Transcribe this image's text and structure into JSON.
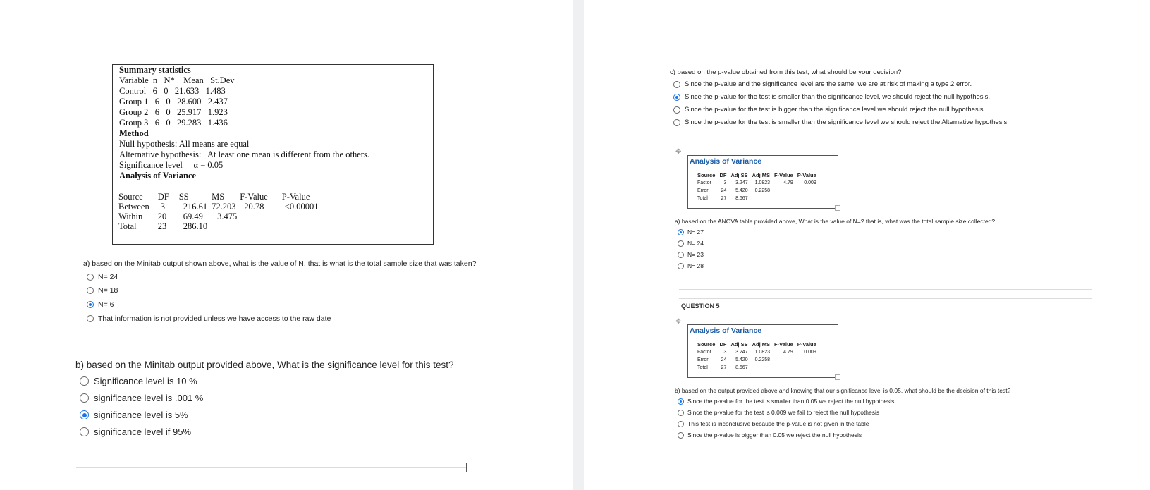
{
  "summary": {
    "lines": [
      {
        "text": "Summary statistics",
        "bold": true
      },
      {
        "text": "Variable  n   N*    Mean   St.Dev",
        "bold": false
      },
      {
        "text": "Control   6   0   21.633   1.483",
        "bold": false
      },
      {
        "text": "Group 1   6   0   28.600   2.437",
        "bold": false
      },
      {
        "text": "Group 2   6   0   25.917   1.923",
        "bold": false
      },
      {
        "text": "Group 3   6   0   29.283   1.436",
        "bold": false
      },
      {
        "text": "Method",
        "bold": true
      },
      {
        "text": "Null hypothesis: All means are equal",
        "bold": false
      },
      {
        "text": "Alternative hypothesis:   At least one mean is different from the others.",
        "bold": false
      },
      {
        "text": "Significance level     α = 0.05",
        "bold": false
      },
      {
        "text": "Analysis of Variance",
        "bold": true
      }
    ],
    "anova_header": [
      "Source",
      "DF",
      "SS",
      "MS",
      "F-Value",
      "P-Value"
    ],
    "anova_rows": [
      [
        "Between",
        "3",
        "216.61",
        "72.203",
        "20.78",
        "<0.00001"
      ],
      [
        "Within",
        "20",
        "69.49",
        "3.475",
        "",
        ""
      ],
      [
        "Total",
        "23",
        "286.10",
        "",
        "",
        ""
      ]
    ]
  },
  "left_questions": {
    "a": {
      "prompt": "a) based on the Minitab output shown above, what is the value of N, that is what is the total sample size that was taken?",
      "options": [
        {
          "label": "N= 24",
          "selected": false
        },
        {
          "label": "N= 18",
          "selected": false
        },
        {
          "label": "N= 6",
          "selected": true
        },
        {
          "label": "That information is not provided unless we have access to the raw date",
          "selected": false
        }
      ]
    },
    "b": {
      "prompt": "b) based on the Minitab output provided above, What is the significance level for this test?",
      "options": [
        {
          "label": "Significance level is 10 %",
          "selected": false
        },
        {
          "label": "significance level is .001 %",
          "selected": false
        },
        {
          "label": "significance level is 5%",
          "selected": true
        },
        {
          "label": "significance level if 95%",
          "selected": false
        }
      ]
    }
  },
  "right_questions": {
    "c": {
      "prompt": "c) based on the p-value obtained from this test, what should be your decision?",
      "options": [
        {
          "label": "Since the p-value and the significance level are the same, we are at risk of making a type 2 error.",
          "selected": false
        },
        {
          "label": "Since the p-value for the test is smaller than the significance level, we should reject the null hypothesis.",
          "selected": true
        },
        {
          "label": "Since the p-value for the test is bigger than the significance level we should reject the null hypothesis",
          "selected": false
        },
        {
          "label": "Since the p-value for the test is smaller than the significance level we should reject the Alternative hypothesis",
          "selected": false
        }
      ]
    },
    "anova_table": {
      "title": "Analysis of Variance",
      "header": [
        "Source",
        "DF",
        "Adj SS",
        "Adj MS",
        "F-Value",
        "P-Value"
      ],
      "rows": [
        [
          "Factor",
          "3",
          "3.247",
          "1.0823",
          "4.79",
          "0.009"
        ],
        [
          "Error",
          "24",
          "5.420",
          "0.2258",
          "",
          ""
        ],
        [
          "Total",
          "27",
          "8.667",
          "",
          "",
          ""
        ]
      ]
    },
    "a2": {
      "prompt": "a) based on the ANOVA table provided above, What is the value of N=? that is, what was the total sample size collected?",
      "options": [
        {
          "label": "N= 27",
          "selected": true
        },
        {
          "label": "N= 24",
          "selected": false
        },
        {
          "label": "N= 23",
          "selected": false
        },
        {
          "label": "N= 28",
          "selected": false
        }
      ]
    },
    "question5_label": "QUESTION 5",
    "b5": {
      "prompt": "b) based on the output provided above and knowing that our significance level is 0.05, what should be the decision of this test?",
      "options": [
        {
          "label": "Since the p-value for the test is smaller than 0.05 we reject the null hypothesis",
          "selected": true
        },
        {
          "label": "Since the p-value for the test is 0.009 we fail to reject the null hypothesis",
          "selected": false
        },
        {
          "label": "This test is inconclusive because the p-value is not given in the table",
          "selected": false
        },
        {
          "label": "Since the p-value is bigger than 0.05 we reject the null hypothesis",
          "selected": false
        }
      ]
    }
  }
}
